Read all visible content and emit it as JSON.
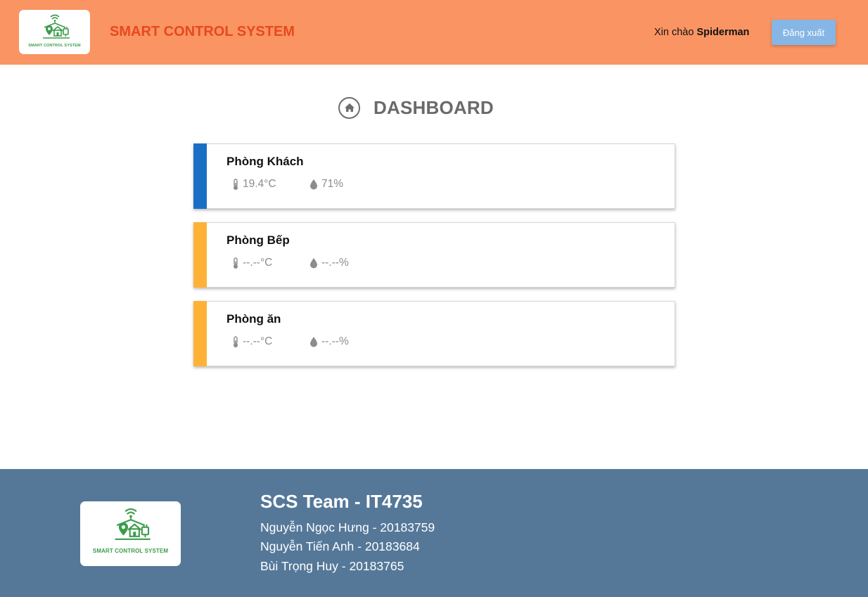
{
  "header": {
    "logo_caption": "SMART CONTROL SYSTEM",
    "app_title": "SMART CONTROL SYSTEM",
    "greeting_prefix": "Xin chào",
    "username": "Spiderman",
    "logout_label": "Đăng xuất"
  },
  "dashboard": {
    "title": "DASHBOARD",
    "icon": "home-icon"
  },
  "rooms": [
    {
      "name": "Phòng Khách",
      "temperature": "19.4°C",
      "humidity": "71%",
      "accent": "#1a6fc4"
    },
    {
      "name": "Phòng Bếp",
      "temperature": "--.--°C",
      "humidity": "--.--%",
      "accent": "#fdb237"
    },
    {
      "name": "Phòng ăn",
      "temperature": "--.--°C",
      "humidity": "--.--%",
      "accent": "#fdb237"
    }
  ],
  "footer": {
    "logo_caption": "SMART CONTROL SYSTEM",
    "team_title": "SCS Team - IT4735",
    "members": [
      "Nguyễn Ngọc Hưng - 20183759",
      "Nguyễn Tiến Anh - 20183684",
      "Bùi Trọng Huy - 20183765"
    ]
  },
  "colors": {
    "header_bg": "#fa9463",
    "title_color": "#e8491d",
    "logout_bg": "#86b6e5",
    "footer_bg": "#557899"
  }
}
